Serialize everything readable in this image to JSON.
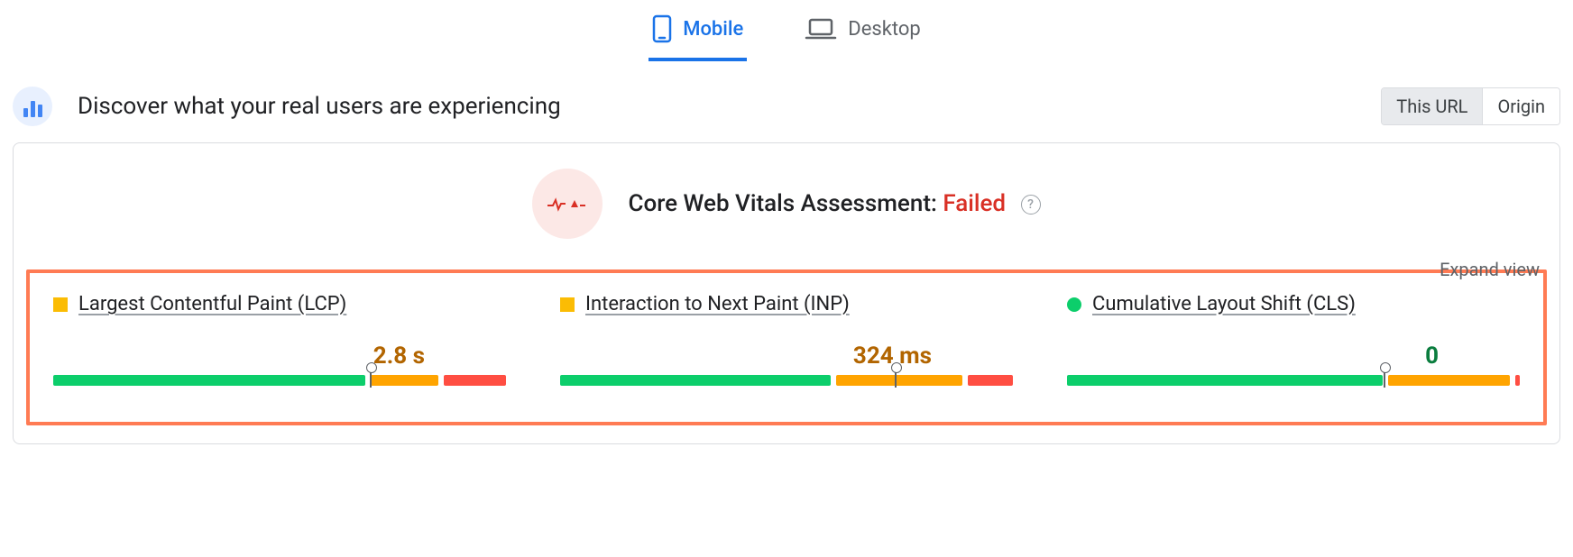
{
  "tabs": {
    "mobile": "Mobile",
    "desktop": "Desktop",
    "active": "mobile"
  },
  "header": {
    "title": "Discover what your real users are experiencing",
    "toggle": {
      "this_url": "This URL",
      "origin": "Origin",
      "active": "this_url"
    }
  },
  "assessment": {
    "label": "Core Web Vitals Assessment: ",
    "status": "Failed"
  },
  "controls": {
    "expand": "Expand view"
  },
  "metrics": {
    "lcp": {
      "name": "Largest Contentful Paint (LCP)",
      "value": "2.8 s",
      "status": "warn",
      "segments": [
        70,
        15,
        14
      ],
      "marker_pct": 70
    },
    "inp": {
      "name": "Interaction to Next Paint (INP)",
      "value": "324 ms",
      "status": "warn",
      "segments": [
        60,
        28,
        10
      ],
      "marker_pct": 74
    },
    "cls": {
      "name": "Cumulative Layout Shift (CLS)",
      "value": "0",
      "status": "good",
      "segments": [
        70,
        27,
        1
      ],
      "marker_pct": 70
    }
  }
}
